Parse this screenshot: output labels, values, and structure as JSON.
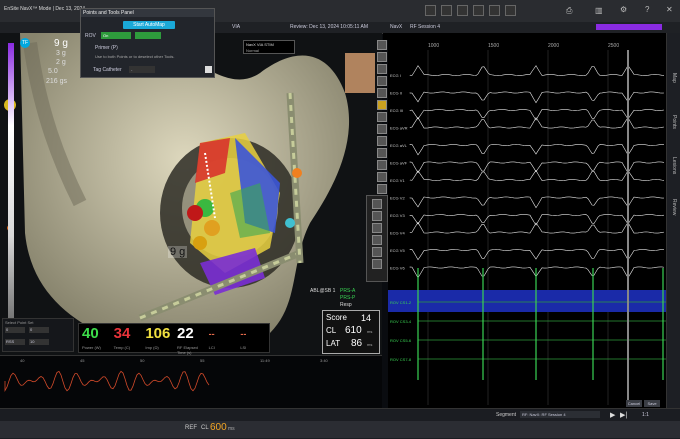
{
  "app": {
    "title": "EnSite NavX™ Mode | Dec 13, 2024",
    "review_label": "Review: Dec 13, 2024 10:05:11 AM",
    "navx_label": "NavX",
    "session_label": "RF Session 4",
    "via_label": "VIA"
  },
  "panel": {
    "title": "Points and Tools Panel",
    "automap_button": "Start AutoMap",
    "roi_label": "ROV",
    "primer_label": "Primer (P)",
    "hint": "Use to both Points or to deselect other Tools.",
    "tag_label": "Tag Catheter",
    "rov_value": "On",
    "catheter_value": "-"
  },
  "via_stim": {
    "label": "NavX VIA STIM",
    "value": "Normal"
  },
  "left_scale": {
    "values": [
      "9 g",
      "3 g",
      "2 g",
      "5.0",
      "216 gs"
    ],
    "title": "Contact"
  },
  "force_label": "9 g",
  "metrics": [
    {
      "value": "40",
      "label": "Power (W)",
      "color": "#3ddc4a"
    },
    {
      "value": "34",
      "label": "Temp (C)",
      "color": "#e8333a"
    },
    {
      "value": "106",
      "label": "Imp (Ω)",
      "color": "#f0e040"
    },
    {
      "value": "22",
      "label": "RF Elapsed Time (s)",
      "color": "#ffffff"
    },
    {
      "value": "--",
      "label": "LCI",
      "color": "#e46a4a"
    },
    {
      "value": "--",
      "label": "LSI",
      "color": "#e46a4a"
    }
  ],
  "score": {
    "score_label": "Score",
    "score_value": "14",
    "cl_label": "CL",
    "cl_value": "610",
    "cl_unit": "ms",
    "lat_label": "LAT",
    "lat_value": "86",
    "lat_unit": "ms"
  },
  "abl": {
    "label": "ABL@SB 1",
    "items": [
      "PRS-A",
      "PRS-P",
      "Resp"
    ]
  },
  "ecg_channels": [
    "ECG I",
    "ECG II",
    "ECG III",
    "ECG aVR",
    "ECG aVL",
    "ECG aVF",
    "ECG V1",
    "ECG V2",
    "ECG V3",
    "ECG V4",
    "ECG V5",
    "ECG V6"
  ],
  "green_channels": [
    "ROV CS1-2",
    "ROV CS3-4",
    "ROV CS5-6",
    "ROV CS7-8"
  ],
  "ecg_ticks": [
    "1000",
    "1500",
    "2000",
    "2500"
  ],
  "side_tabs": [
    "Map",
    "Points",
    "Lesions",
    "Review"
  ],
  "bottom": {
    "segment_label": "Segment",
    "segment_value": "RF: NavX: RF Session 4",
    "cancel": "Cancel",
    "save": "Save",
    "zoom": "1:1"
  },
  "ref": {
    "label": "REF",
    "cl_label": "CL",
    "cl_value": "600",
    "cl_unit": "ms"
  },
  "resp_ticks": [
    "40",
    "45",
    "50",
    "55",
    "11:49",
    "3:40"
  ],
  "small_fields": [
    "Select Point Set",
    "0",
    "0",
    "0",
    "RSS",
    "10"
  ],
  "colors": {
    "accent": "#00c8e0",
    "purple": "#8a2be2",
    "green": "#39d353"
  },
  "icons": [
    "settings-icon",
    "list-icon",
    "grid-icon",
    "camera-icon",
    "close-icon"
  ]
}
